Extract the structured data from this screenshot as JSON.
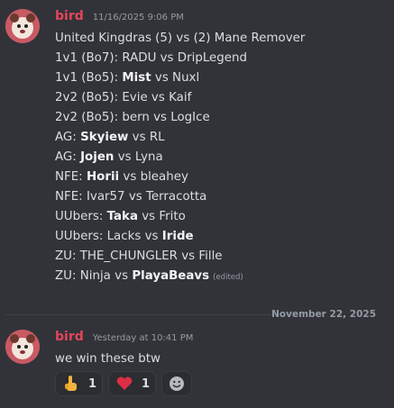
{
  "message1": {
    "username": "bird",
    "timestamp": "11/16/2025 9:06 PM",
    "lines": [
      [
        {
          "t": "United Kingdras (5) vs (2) Mane Remover"
        }
      ],
      [
        {
          "t": "1v1 (Bo7): RADU vs DripLegend"
        }
      ],
      [
        {
          "t": "1v1 (Bo5): "
        },
        {
          "t": "Mist",
          "b": true
        },
        {
          "t": " vs Nuxl"
        }
      ],
      [
        {
          "t": "2v2 (Bo5): Evie vs Kaif"
        }
      ],
      [
        {
          "t": "2v2 (Bo5): bern vs LogIce"
        }
      ],
      [
        {
          "t": "AG: "
        },
        {
          "t": "Skyiew",
          "b": true
        },
        {
          "t": " vs RL"
        }
      ],
      [
        {
          "t": "AG: "
        },
        {
          "t": "Jojen",
          "b": true
        },
        {
          "t": " vs Lyna"
        }
      ],
      [
        {
          "t": "NFE: "
        },
        {
          "t": "Horii",
          "b": true
        },
        {
          "t": " vs bleahey"
        }
      ],
      [
        {
          "t": "NFE: Ivar57 vs Terracotta"
        }
      ],
      [
        {
          "t": "UUbers: "
        },
        {
          "t": "Taka",
          "b": true
        },
        {
          "t": " vs Frito"
        }
      ],
      [
        {
          "t": "UUbers: Lacks vs "
        },
        {
          "t": "Iride",
          "b": true
        }
      ],
      [
        {
          "t": "ZU: THE_CHUNGLER vs Fille"
        }
      ],
      [
        {
          "t": "ZU: Ninja vs "
        },
        {
          "t": "PlayaBeavs",
          "b": true
        }
      ]
    ],
    "edited_label": "(edited)"
  },
  "date_divider": "November 22, 2025",
  "message2": {
    "username": "bird",
    "timestamp": "Yesterday at 10:41 PM",
    "text": "we win these btw",
    "reactions": [
      {
        "emoji": "pointing-up-hand-icon",
        "count": "1"
      },
      {
        "emoji": "red-heart-icon",
        "count": "1"
      }
    ],
    "add_reaction_icon": "add-reaction-smiley-icon"
  },
  "colors": {
    "background": "#323339",
    "username": "#e4455a",
    "text": "#dbdee1",
    "muted": "#949ba4"
  }
}
